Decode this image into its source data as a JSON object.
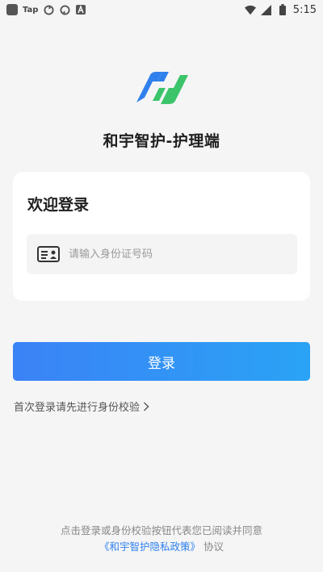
{
  "status_bar": {
    "app_label": "Tap",
    "time": "5:15",
    "icons": [
      "notification-square-icon",
      "tap-app-icon",
      "sync-icon",
      "sync-icon",
      "a-box-icon",
      "wifi-icon",
      "signal-icon",
      "battery-icon"
    ]
  },
  "app": {
    "title": "和宇智护-护理端",
    "logo_colors": {
      "blue": "#2f80ed",
      "green": "#3cc46b"
    }
  },
  "card": {
    "title": "欢迎登录",
    "id_field": {
      "value": "",
      "placeholder": "请输入身份证号码",
      "icon": "id-card-icon"
    }
  },
  "actions": {
    "login_label": "登录",
    "verify_link": "首次登录请先进行身份校验"
  },
  "agreement": {
    "line1": "点击登录或身份校验按钮代表您已阅读并同意",
    "privacy_link": "《和宇智护隐私政策》",
    "suffix": "协议"
  },
  "colors": {
    "button_gradient_start": "#3b82f6",
    "button_gradient_end": "#2aa3f5",
    "link": "#2f80ed",
    "background": "#f5f5f6"
  }
}
